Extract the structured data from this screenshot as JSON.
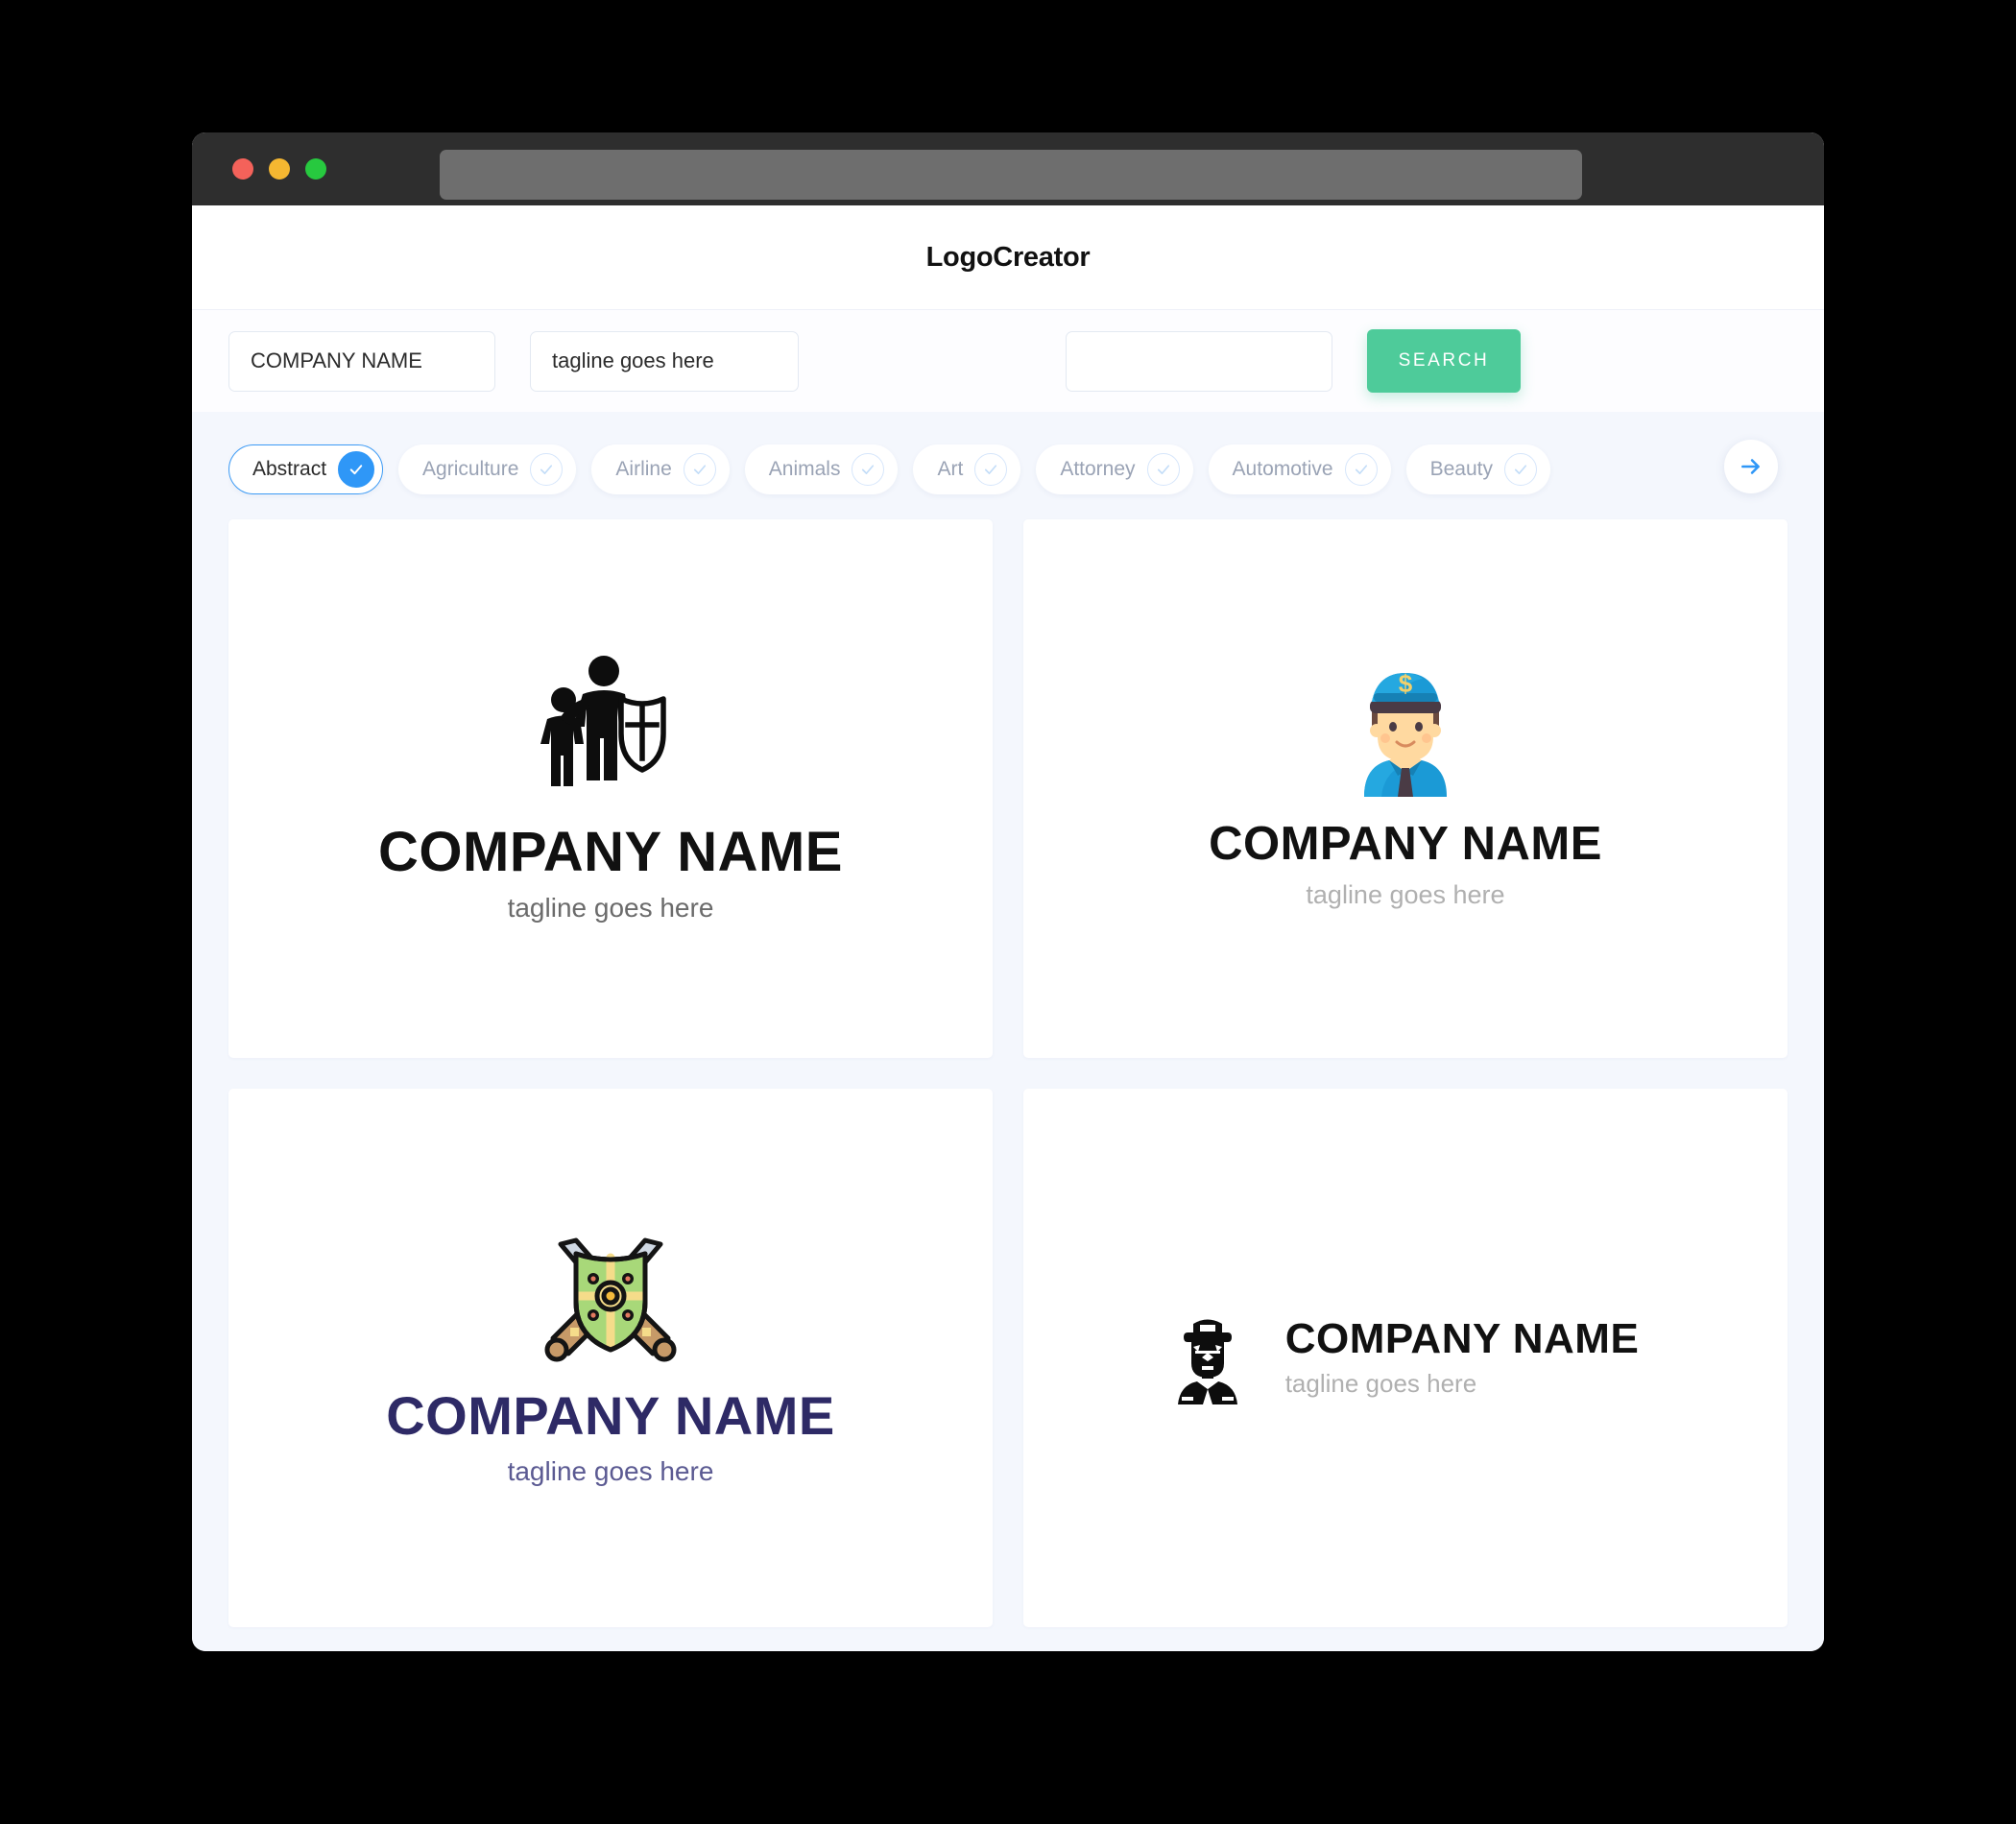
{
  "window": {
    "traffic_lights": [
      "close",
      "minimize",
      "maximize"
    ],
    "url_value": ""
  },
  "header": {
    "app_title": "LogoCreator"
  },
  "search": {
    "company_name_value": "COMPANY NAME",
    "company_name_placeholder": "COMPANY NAME",
    "tagline_value": "tagline goes here",
    "tagline_placeholder": "tagline goes here",
    "keyword_value": "",
    "keyword_placeholder": "",
    "search_button_label": "SEARCH"
  },
  "categories": {
    "next_arrow_icon": "arrow-right-icon",
    "items": [
      {
        "label": "Abstract",
        "selected": true
      },
      {
        "label": "Agriculture",
        "selected": false
      },
      {
        "label": "Airline",
        "selected": false
      },
      {
        "label": "Animals",
        "selected": false
      },
      {
        "label": "Art",
        "selected": false
      },
      {
        "label": "Attorney",
        "selected": false
      },
      {
        "label": "Automotive",
        "selected": false
      },
      {
        "label": "Beauty",
        "selected": false
      }
    ]
  },
  "logos": [
    {
      "icon": "guardian-shield-cross-icon",
      "name": "COMPANY NAME",
      "tagline": "tagline goes here",
      "name_color": "#111111",
      "tagline_color": "#6b6b6b",
      "layout": "vertical"
    },
    {
      "icon": "police-officer-dollar-cap-icon",
      "name": "COMPANY NAME",
      "tagline": "tagline goes here",
      "name_color": "#111111",
      "tagline_color": "#b0b0b0",
      "layout": "vertical"
    },
    {
      "icon": "crossed-swords-shield-icon",
      "name": "COMPANY NAME",
      "tagline": "tagline goes here",
      "name_color": "#2e2a66",
      "tagline_color": "#5b5a92",
      "layout": "vertical"
    },
    {
      "icon": "officer-silhouette-icon",
      "name": "COMPANY NAME",
      "tagline": "tagline goes here",
      "name_color": "#111111",
      "tagline_color": "#b0b0b0",
      "layout": "horizontal"
    }
  ],
  "colors": {
    "accent_green": "#4ecb9a",
    "accent_blue": "#2f97f7",
    "page_background": "#f4f7fd",
    "chrome_dark": "#2e2e2e",
    "navy": "#2e2a66"
  }
}
